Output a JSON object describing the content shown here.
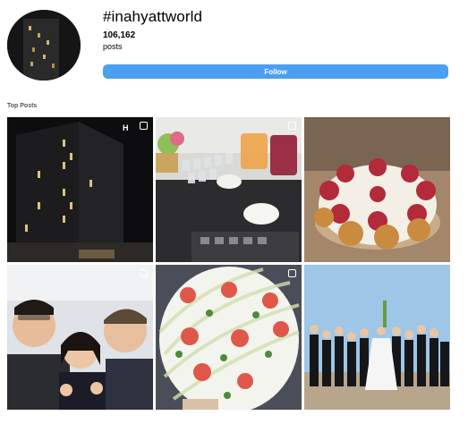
{
  "profile": {
    "hashtag": "#inahyattworld",
    "post_count": "106,162",
    "posts_label": "posts",
    "follow_label": "Follow",
    "avatar_icon": "hotel-building-night-photo"
  },
  "section": {
    "title": "Top Posts"
  },
  "posts": [
    {
      "description_icon": "hotel-night-photo",
      "overlay_text": "H"
    },
    {
      "description_icon": "buffet-table-photo"
    },
    {
      "description_icon": "strawberry-cream-puff-cake-photo"
    },
    {
      "description_icon": "selfie-three-people-photo"
    },
    {
      "description_icon": "strawberry-cake-photo"
    },
    {
      "description_icon": "wedding-party-photo"
    }
  ],
  "colors": {
    "accent": "#4a9ff0",
    "text": "#000000",
    "muted": "#555555"
  }
}
